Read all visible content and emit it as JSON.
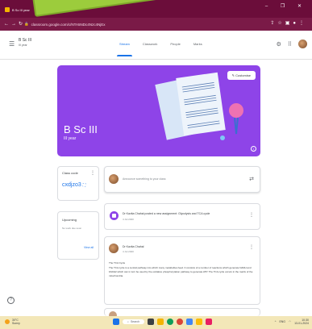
{
  "browser": {
    "tab_title": "B Sc III year",
    "url": "classroom.google.com/c/NTA5NDc4Nzc4NjEx",
    "window_controls": "–  ❐  ✕"
  },
  "header": {
    "class_title": "B Sc III",
    "class_subtitle": "III year",
    "tabs": [
      {
        "label": "Stream"
      },
      {
        "label": "Classwork"
      },
      {
        "label": "People"
      },
      {
        "label": "Marks"
      }
    ]
  },
  "banner": {
    "title": "B Sc III",
    "subtitle": "III year",
    "customise_label": "Customise",
    "color": "#8e44e8"
  },
  "class_code": {
    "label": "Class code",
    "value": "cxdjzo3"
  },
  "upcoming": {
    "title": "Upcoming",
    "empty_text": "No work due soon",
    "view_all": "View all"
  },
  "stream": {
    "announce_placeholder": "Announce something to your class",
    "posts": [
      {
        "title": "Dr Kavita Chahal posted a new assignment: Glycolysis and TCA cycle",
        "date": "4 Jul 2020"
      },
      {
        "author": "Dr Kavita Chahal",
        "date": "4 Jul 2020",
        "heading": "The TCA Cycle",
        "body": "The TCA cycle is a central pathway into which many metabolites feed. It consists of a number of reactions which generate NADH and FADH2 which can in turn be used by the oxidative phosphorylation pathway to generate ATP. The TCA cycle occurs in the matrix of the mitochondria."
      }
    ]
  },
  "taskbar": {
    "weather_temp": "30°C",
    "weather_text": "Sunny",
    "search_label": "Search",
    "lang": "ENG",
    "time": "10:30",
    "date": "13-01-2024"
  }
}
